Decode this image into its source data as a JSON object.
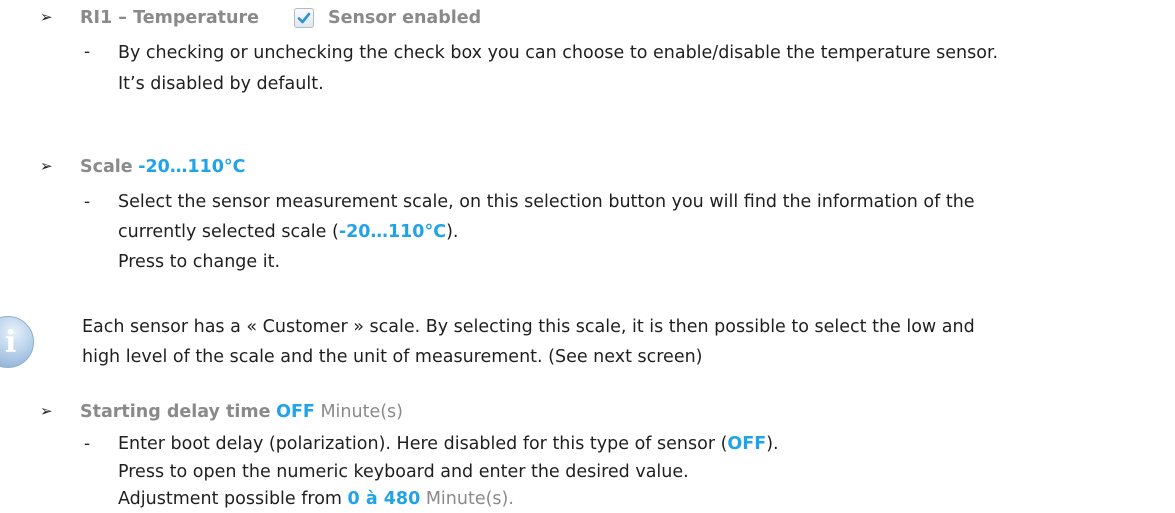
{
  "items": {
    "ri1": {
      "bullet": "➢",
      "title": "RI1 – Temperature",
      "checkbox_checked": true,
      "checkbox_label": "Sensor enabled",
      "dash": "-",
      "line1": "By checking or unchecking the check box you can choose to enable/disable the temperature sensor.",
      "line2": "It’s disabled by default."
    },
    "scale": {
      "bullet": "➢",
      "title": "Scale",
      "value": "-20…110°C",
      "dash": "-",
      "line1": "Select the sensor measurement scale, on this selection button you will find the information of the",
      "line2_prefix": "currently selected scale (",
      "line2_value": "-20…110°C",
      "line2_suffix": ").",
      "line3": "Press to change it."
    },
    "note": {
      "icon": "info-icon",
      "line1": "Each sensor has a « Customer » scale. By selecting this scale, it is then possible to select the low and",
      "line2": "high level of the scale and the unit of measurement. (See next screen)"
    },
    "delay": {
      "bullet": "➢",
      "title": "Starting delay time",
      "value": "OFF",
      "unit": "Minute(s)",
      "dash": "-",
      "line1_prefix": "Enter boot delay (polarization). Here disabled for this type of sensor (",
      "line1_value": "OFF",
      "line1_suffix": ").",
      "line2": "Press to open the numeric keyboard and enter the desired value.",
      "line3_prefix": "Adjustment possible from ",
      "line3_value": "0 à 480",
      "line3_unit": "Minute(s)."
    }
  },
  "colors": {
    "accent_blue": "#21a3e8",
    "label_gray": "#8a8a8a",
    "text": "#1f1f1f"
  }
}
